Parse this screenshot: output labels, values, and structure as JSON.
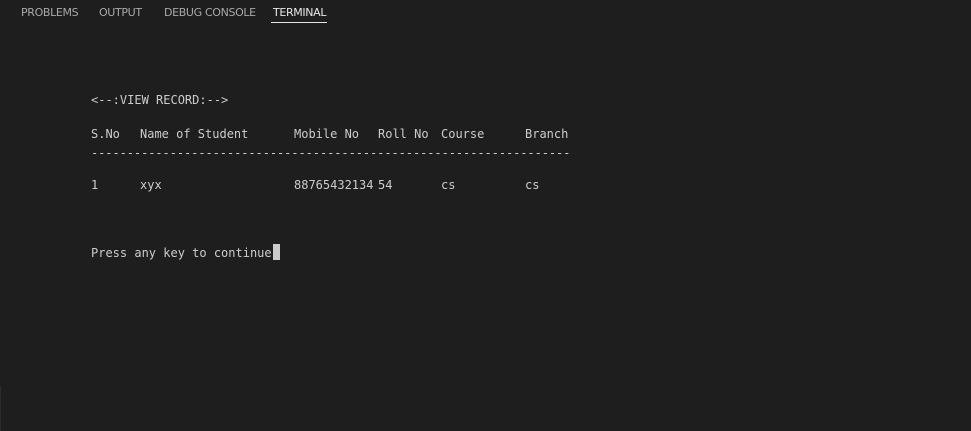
{
  "tabs": [
    {
      "label": "PROBLEMS",
      "active": false
    },
    {
      "label": "OUTPUT",
      "active": false
    },
    {
      "label": "DEBUG CONSOLE",
      "active": false
    },
    {
      "label": "TERMINAL",
      "active": true
    }
  ],
  "terminal": {
    "heading": "<--:VIEW RECORD:-->",
    "columns": [
      "S.No",
      "Name of Student",
      "Mobile No",
      "Roll No",
      "Course",
      "Branch"
    ],
    "separator": "-------------------------------------------------------------------",
    "rows": [
      [
        "1",
        "xyx",
        "88765432134",
        "54",
        "cs",
        "cs"
      ]
    ],
    "prompt": "Press any key to continue."
  },
  "colors": {
    "background": "#1e1e1e",
    "text": "#cccccc",
    "tab_inactive": "#a9a9a9",
    "tab_active": "#e7e7e7"
  }
}
